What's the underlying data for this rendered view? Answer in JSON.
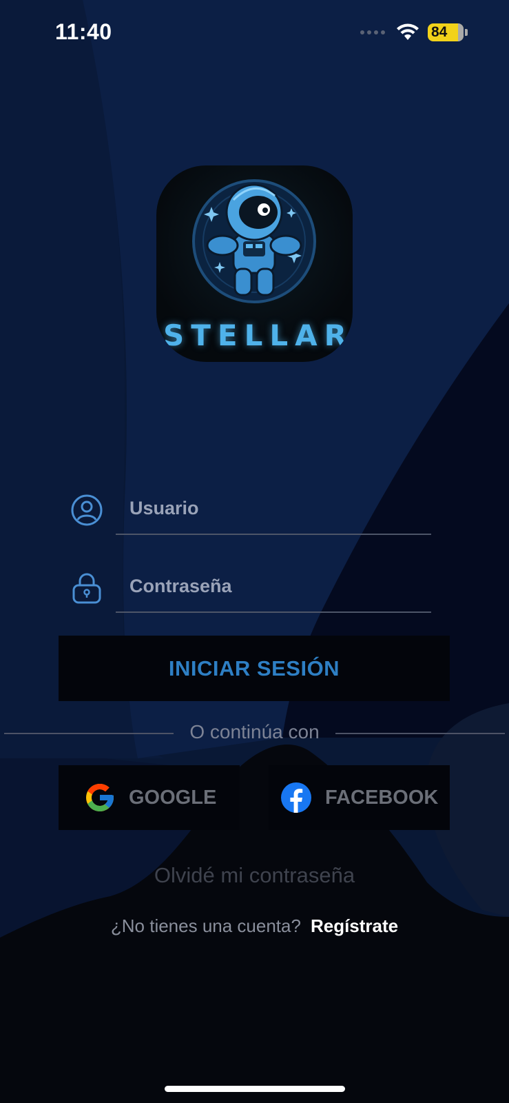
{
  "status_bar": {
    "time": "11:40",
    "battery": "84"
  },
  "brand": {
    "name": "STELLAR"
  },
  "form": {
    "username_placeholder": "Usuario",
    "password_placeholder": "Contraseña",
    "login_label": "INICIAR SESIÓN"
  },
  "divider_text": "O continúa con",
  "social": {
    "google_label": "GOOGLE",
    "facebook_label": "FACEBOOK"
  },
  "forgot_label": "Olvidé mi contraseña",
  "signup": {
    "question": "¿No tienes una cuenta?",
    "link": "Regístrate"
  },
  "colors": {
    "background_top": "#0c1c3d",
    "accent": "#2e7fc4",
    "brand_text": "#4fb2ea",
    "battery": "#f2d21a"
  },
  "icons": [
    "wifi-icon",
    "battery-icon",
    "user-icon",
    "lock-icon",
    "google-icon",
    "facebook-icon"
  ]
}
